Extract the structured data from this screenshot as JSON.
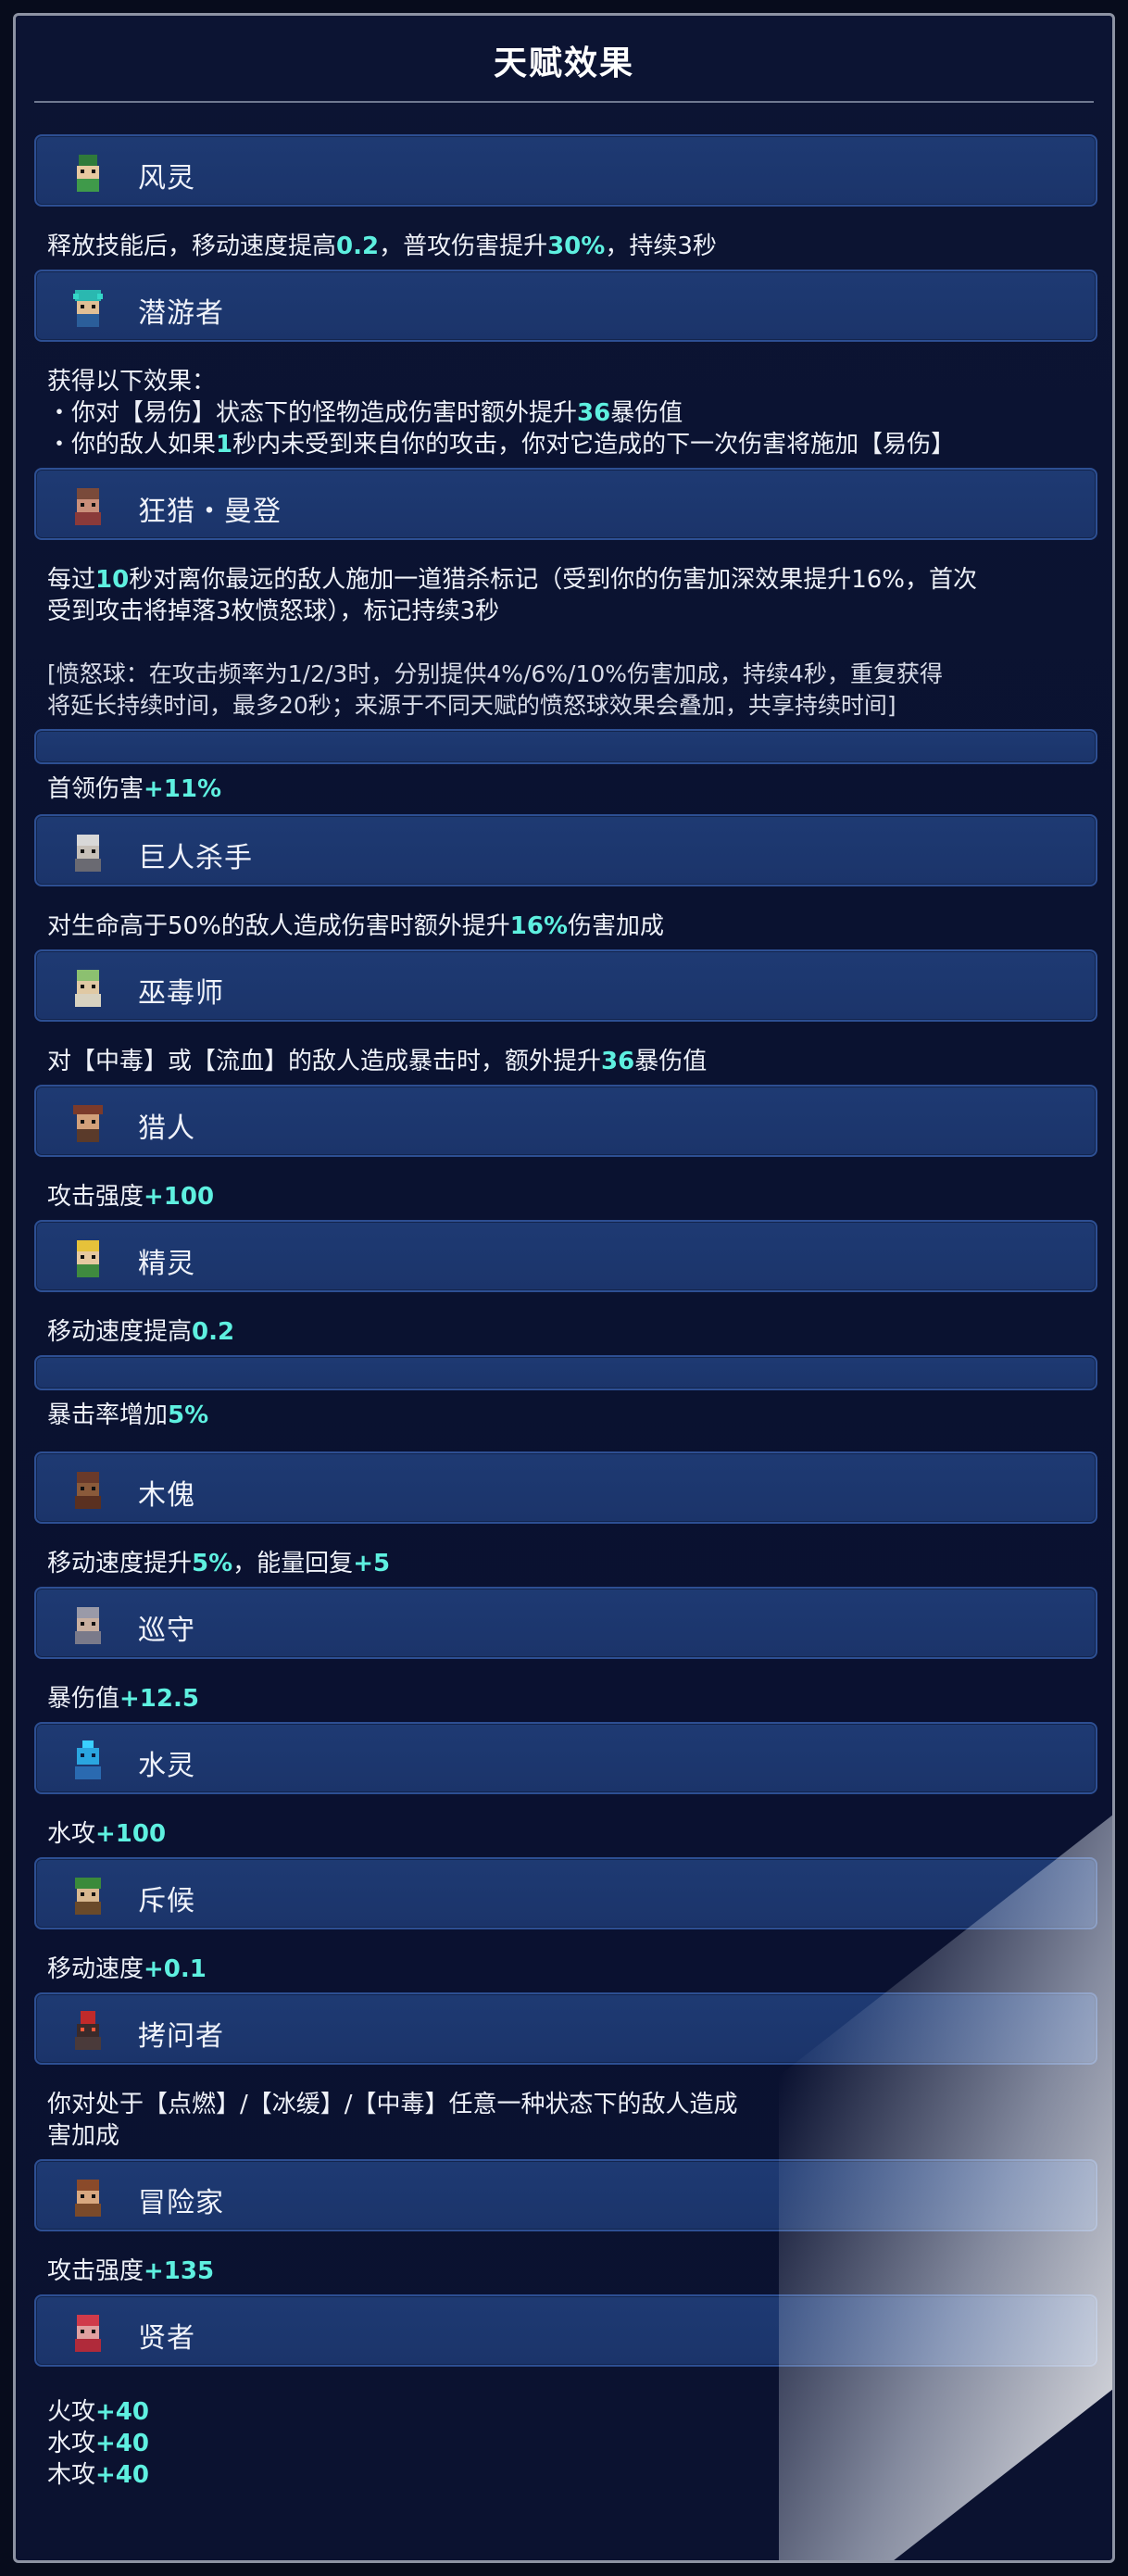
{
  "title": "天赋效果",
  "talents": [
    {
      "name": "风灵",
      "icon": "wind-spirit-icon",
      "desc": [
        "释放技能后，移动速度提高",
        "0.2",
        "，普攻伤害提升",
        "30%",
        "，持续3秒"
      ]
    },
    {
      "name": "潜游者",
      "icon": "diver-icon",
      "line1": "获得以下效果：",
      "line2": [
        "・你对【易伤】状态下的怪物造成伤害时额外提升",
        "36",
        "暴伤值"
      ],
      "line3": [
        "・你的敌人如果",
        "1",
        "秒内未受到来自你的攻击，你对它造成的下一次伤害将施加【易伤】"
      ]
    },
    {
      "name": "狂猎・曼登",
      "icon": "wild-hunt-icon",
      "line1": [
        "每过",
        "10",
        "秒对离你最远的敌人施加一道猎杀标记（受到你的伤害加深效果提升16%，首次"
      ],
      "line2": "受到攻击将掉落3枚愤怒球），标记持续3秒",
      "note1": "[愤怒球：在攻击频率为1/2/3时，分别提供4%/6%/10%伤害加成，持续4秒，重复获得",
      "note2": "将延长持续时间，最多20秒；来源于不同天赋的愤怒球效果会叠加，共享持续时间]"
    },
    {
      "name": "",
      "icon": "",
      "desc": [
        "首领伤害",
        "+11%"
      ]
    },
    {
      "name": "巨人杀手",
      "icon": "giant-slayer-icon",
      "desc": [
        "对生命高于50%的敌人造成伤害时额外提升",
        "16%",
        "伤害加成"
      ]
    },
    {
      "name": "巫毒师",
      "icon": "voodoo-icon",
      "desc": [
        "对【中毒】或【流血】的敌人造成暴击时，额外提升",
        "36",
        "暴伤值"
      ]
    },
    {
      "name": "猎人",
      "icon": "hunter-icon",
      "desc": [
        "攻击强度",
        "+100"
      ]
    },
    {
      "name": "精灵",
      "icon": "elf-icon",
      "desc": [
        "移动速度提高",
        "0.2"
      ]
    },
    {
      "name": "",
      "icon": "",
      "desc": [
        "暴击率增加",
        "5%"
      ]
    },
    {
      "name": "木傀",
      "icon": "wood-puppet-icon",
      "desc": [
        "移动速度提升",
        "5%",
        "，能量回复",
        "+5"
      ]
    },
    {
      "name": "巡守",
      "icon": "patrol-icon",
      "desc": [
        "暴伤值",
        "+12.5"
      ]
    },
    {
      "name": "水灵",
      "icon": "water-spirit-icon",
      "desc": [
        "水攻",
        "+100"
      ]
    },
    {
      "name": "斥候",
      "icon": "scout-icon",
      "desc": [
        "移动速度",
        "+0.1"
      ]
    },
    {
      "name": "拷问者",
      "icon": "torturer-icon",
      "line1": "你对处于【点燃】/【冰缓】/【中毒】任意一种状态下的敌人造成",
      "line2": "害加成"
    },
    {
      "name": "冒险家",
      "icon": "adventurer-icon",
      "desc": [
        "攻击强度",
        "+135"
      ]
    },
    {
      "name": "贤者",
      "icon": "sage-icon",
      "lines": [
        [
          "火攻",
          "+40"
        ],
        [
          "水攻",
          "+40"
        ],
        [
          "木攻",
          "+40"
        ]
      ]
    }
  ],
  "colors": {
    "highlight": "#5ef0e0",
    "header": "#1e3a73",
    "background": "#0a1230"
  }
}
